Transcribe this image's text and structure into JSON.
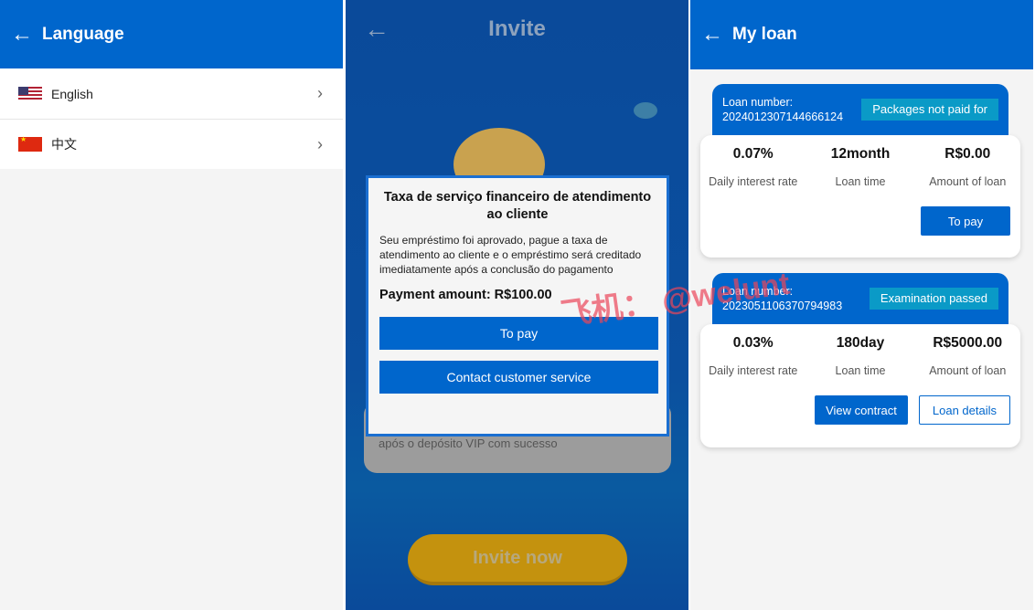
{
  "language": {
    "title": "Language",
    "items": [
      {
        "label": "English",
        "flag": "us-flag-icon"
      },
      {
        "label": "中文",
        "flag": "cn-flag-icon"
      }
    ]
  },
  "invite": {
    "title": "Invite",
    "background_text": "após o depósito VIP com sucesso",
    "invite_now": "Invite now",
    "modal": {
      "title": "Taxa de serviço financeiro de atendimento ao cliente",
      "message": "Seu empréstimo foi aprovado, pague a taxa de atendimento ao cliente e o empréstimo será creditado imediatamente após a conclusão do pagamento",
      "amount": "Payment amount: R$100.00",
      "pay": "To pay",
      "contact": "Contact customer service"
    }
  },
  "watermark": "飞机： @welunt",
  "myloan": {
    "title": "My loan",
    "loans": [
      {
        "number": "Loan number: 2024012307144666124",
        "status": "Packages not paid for",
        "rate": "0.07%",
        "rate_label": "Daily interest rate",
        "time": "12month",
        "time_label": "Loan time",
        "amount": "R$0.00",
        "amount_label": "Amount of loan",
        "actions": [
          "To pay"
        ]
      },
      {
        "number": "Loan number: 2023051106370794983",
        "status": "Examination passed",
        "rate": "0.03%",
        "rate_label": "Daily interest rate",
        "time": "180day",
        "time_label": "Loan time",
        "amount": "R$5000.00",
        "amount_label": "Amount of loan",
        "actions": [
          "View contract",
          "Loan details"
        ]
      }
    ]
  },
  "colors": {
    "primary": "#0066cc",
    "badge": "#0a9ac7"
  }
}
